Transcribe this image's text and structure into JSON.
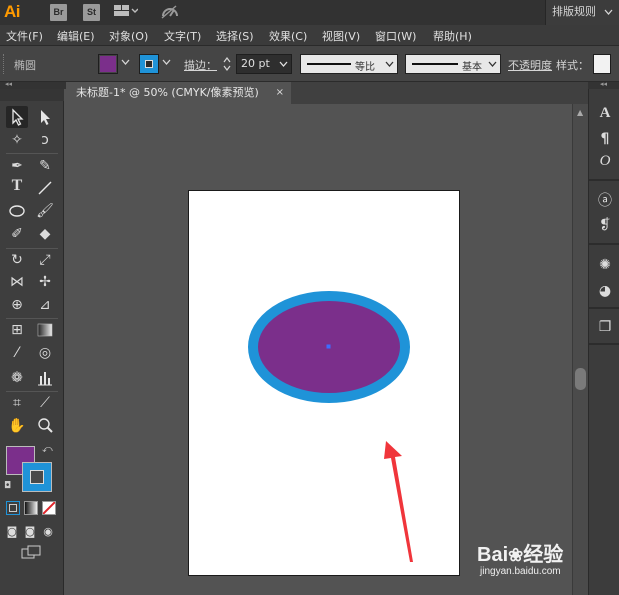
{
  "app": {
    "logo": "Ai",
    "badges": [
      "Br",
      "St"
    ],
    "workspace": "排版规则"
  },
  "menu": [
    "文件(F)",
    "编辑(E)",
    "对象(O)",
    "文字(T)",
    "选择(S)",
    "效果(C)",
    "视图(V)",
    "窗口(W)",
    "帮助(H)"
  ],
  "control": {
    "shape_label": "椭圆",
    "fill_color": "#7b2f8b",
    "stroke_color": "#1f93d8",
    "stroke_label": "描边：",
    "stroke_value": "20 pt",
    "profile_label": "等比",
    "brush_label": "基本",
    "opacity_label": "不透明度",
    "style_label": "样式："
  },
  "document": {
    "tab_title": "未标题-1* @ 50% (CMYK/像素预览)",
    "close_glyph": "×"
  },
  "artwork": {
    "ellipse_fill": "#7b2f8b",
    "ellipse_stroke": "#1f93d8",
    "arrow_color": "#f0353b"
  },
  "watermark": {
    "logo_text": "Bai",
    "logo_suffix": "经验",
    "url": "jingyan.baidu.com"
  }
}
